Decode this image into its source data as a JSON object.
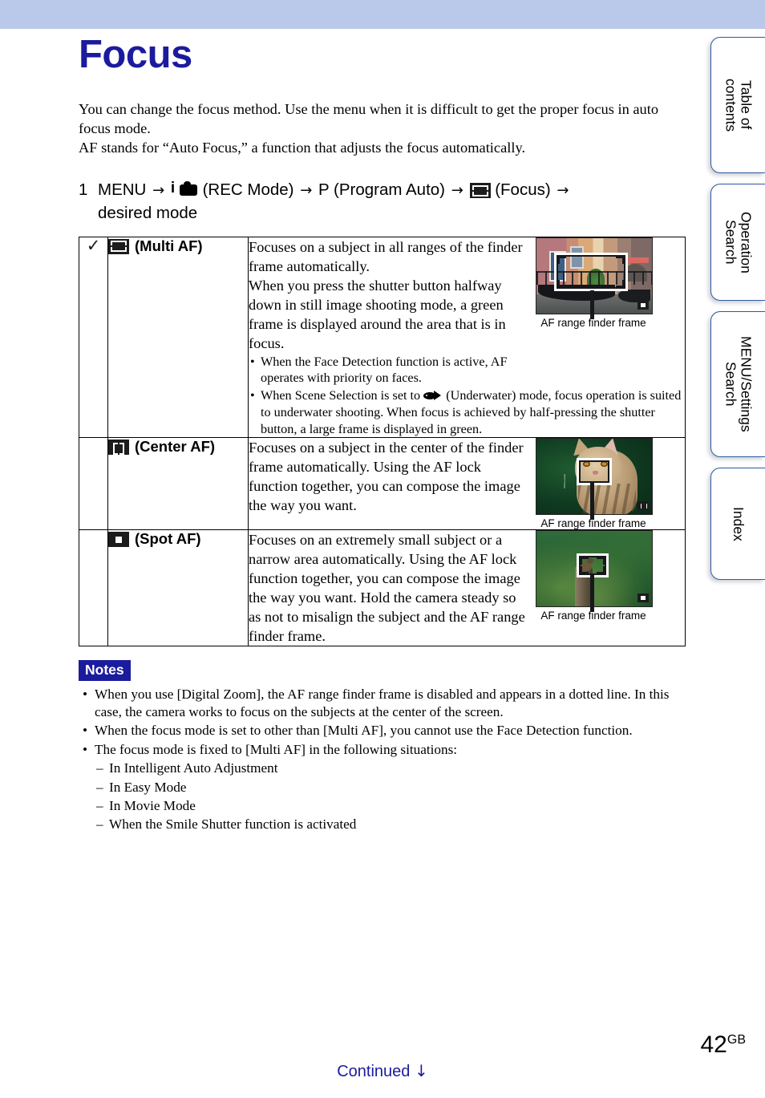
{
  "document": {
    "title": "Focus",
    "page_number": "42",
    "page_suffix": "GB",
    "continued_label": "Continued",
    "continued_arrow": "↓",
    "title_color": "#1b1b9e",
    "banner_color": "#bac8ea"
  },
  "tabs": [
    {
      "label": "Table of\ncontents",
      "name": "table-of-contents"
    },
    {
      "label": "Operation\nSearch",
      "name": "operation-search"
    },
    {
      "label": "MENU/Settings\nSearch",
      "name": "menu-settings-search"
    },
    {
      "label": "Index",
      "name": "index"
    }
  ],
  "intro": {
    "line1": "You can change the focus method. Use the menu when it is difficult to get the proper focus in auto focus mode.",
    "line2": "AF stands for “Auto Focus,” a function that adjusts the focus automatically."
  },
  "step": {
    "number": "1",
    "menu": "MENU",
    "arrow": "→",
    "rec_mode_label": "(REC Mode)",
    "program_letter": "P",
    "program_label": "(Program Auto)",
    "focus_label": "(Focus)",
    "desired_mode": "desired mode",
    "icons": {
      "rec_mode": "rec-mode-icon",
      "focus": "multi-af-icon"
    }
  },
  "table": {
    "rows": [
      {
        "checked": true,
        "check_glyph": "✓",
        "icon": "multi-af-icon",
        "mode_label": "(Multi AF)",
        "description": "Focuses on a subject in all ranges of the finder frame automatically.\nWhen you press the shutter button halfway down in still image shooting mode, a green frame is displayed around the area that is in focus.",
        "desc_p1": "Focuses on a subject in all ranges of the finder frame automatically.",
        "desc_p2": "When you press the shutter button halfway down in still image shooting mode, a green frame is displayed around the area that is in focus.",
        "bullets": [
          "When the Face Detection function is active, AF operates with priority on faces.",
          "When Scene Selection is set to  (Underwater) mode, focus operation is suited to underwater shooting. When focus is achieved by half-pressing the shutter button, a large frame is displayed in green."
        ],
        "bullet2_pre": "When Scene Selection is set to",
        "bullet2_post": "(Underwater) mode, focus operation is suited to underwater shooting. When focus is achieved by half-pressing the shutter button, a large frame is displayed in green.",
        "figure_caption": "AF range finder frame",
        "figure_scene": "venice-canal-gondola"
      },
      {
        "checked": false,
        "check_glyph": "",
        "icon": "center-af-icon",
        "mode_label": "(Center AF)",
        "desc_p1": "Focuses on a subject in the center of the finder frame automatically. Using the AF lock function together, you can compose the image the way you want.",
        "desc_p2": "",
        "bullets": [],
        "figure_caption": "AF range finder frame",
        "figure_scene": "tabby-cat"
      },
      {
        "checked": false,
        "check_glyph": "",
        "icon": "spot-af-icon",
        "mode_label": "(Spot AF)",
        "desc_p1": "Focuses on an extremely small subject or a narrow area automatically. Using the AF lock function together, you can compose the image the way you want. Hold the camera steady so as not to misalign the subject and the AF range finder frame.",
        "desc_p2": "",
        "bullets": [],
        "figure_caption": "AF range finder frame",
        "figure_scene": "bird-on-stump"
      }
    ]
  },
  "notes": {
    "heading": "Notes",
    "items": [
      "When you use [Digital Zoom], the AF range finder frame is disabled and appears in a dotted line. In this case, the camera works to focus on the subjects at the center of the screen.",
      "When the focus mode is set to other than [Multi AF], you cannot use the Face Detection function.",
      "The focus mode is fixed to [Multi AF] in the following situations:"
    ],
    "sub_items": [
      "In Intelligent Auto Adjustment",
      "In Easy Mode",
      "In Movie Mode",
      "When the Smile Shutter function is activated"
    ]
  }
}
